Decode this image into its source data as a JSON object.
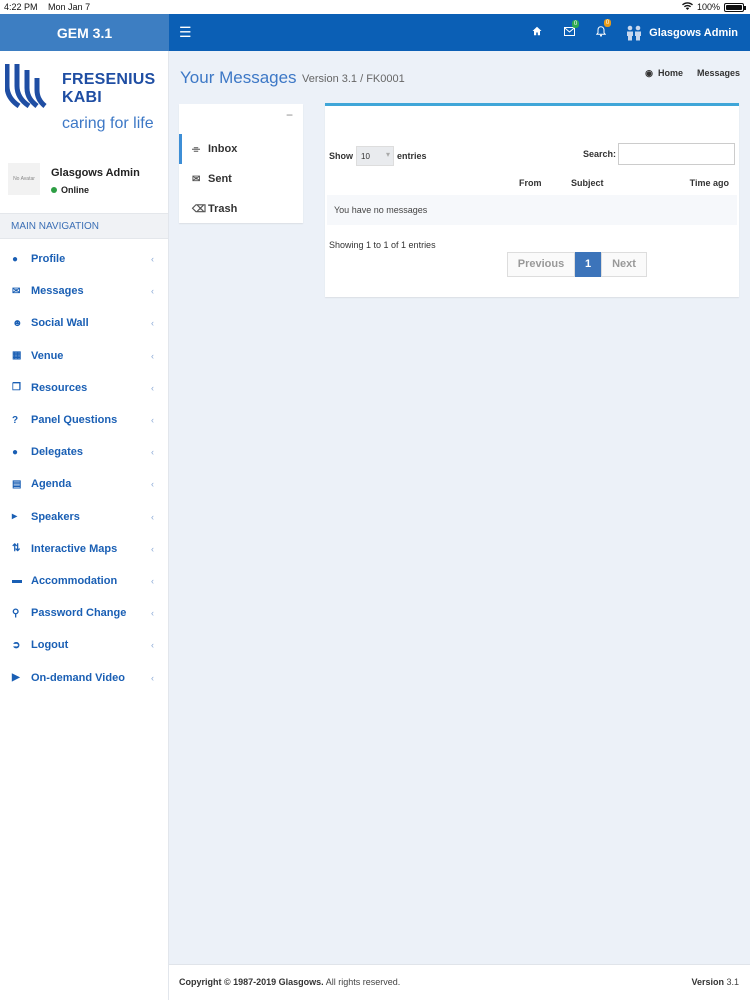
{
  "status_bar": {
    "time": "4:22 PM",
    "date": "Mon Jan 7",
    "battery": "100%"
  },
  "app": {
    "brand": "GEM 3.1"
  },
  "header": {
    "mail_badge": "0",
    "bell_badge": "0",
    "user_name": "Glasgows Admin",
    "colors": {
      "brand_bg": "#3d7ec2",
      "navbar_bg": "#0b5fb5"
    }
  },
  "logo": {
    "line1": "FRESENIUS",
    "line2": "KABI",
    "tagline": "caring for life"
  },
  "user_panel": {
    "avatar_text": "No Avatar",
    "name": "Glasgows Admin",
    "status": "Online"
  },
  "sidebar": {
    "header": "MAIN NAVIGATION",
    "items": [
      {
        "label": "Profile",
        "icon": "user-icon"
      },
      {
        "label": "Messages",
        "icon": "envelope-icon"
      },
      {
        "label": "Social Wall",
        "icon": "users-icon"
      },
      {
        "label": "Venue",
        "icon": "building-icon"
      },
      {
        "label": "Resources",
        "icon": "copy-icon"
      },
      {
        "label": "Panel Questions",
        "icon": "question-icon"
      },
      {
        "label": "Delegates",
        "icon": "user-icon"
      },
      {
        "label": "Agenda",
        "icon": "calendar-icon"
      },
      {
        "label": "Speakers",
        "icon": "bullhorn-icon"
      },
      {
        "label": "Interactive Maps",
        "icon": "signpost-icon"
      },
      {
        "label": "Accommodation",
        "icon": "bed-icon"
      },
      {
        "label": "Password Change",
        "icon": "key-icon"
      },
      {
        "label": "Logout",
        "icon": "sign-out-icon"
      },
      {
        "label": "On-demand Video",
        "icon": "youtube-icon"
      }
    ]
  },
  "page": {
    "title": "Your Messages",
    "subtitle": "Version 3.1 / FK0001",
    "breadcrumb": {
      "home": "Home",
      "current": "Messages"
    }
  },
  "folders": {
    "collapse": "−",
    "items": [
      {
        "label": "Inbox",
        "icon": "inbox-icon"
      },
      {
        "label": "Sent",
        "icon": "envelope-icon"
      },
      {
        "label": "Trash",
        "icon": "trash-icon"
      }
    ]
  },
  "messages_table": {
    "show_label": "Show",
    "page_size": "10",
    "entries_label": "entries",
    "search_label": "Search:",
    "search_value": "",
    "columns": [
      "From",
      "Subject",
      "Time ago"
    ],
    "empty_text": "You have no messages",
    "info": "Showing 1 to 1 of 1 entries",
    "pagination": {
      "previous": "Previous",
      "current": "1",
      "next": "Next"
    }
  },
  "footer": {
    "copyright_bold": "Copyright © 1987-2019 Glasgows.",
    "copyright_rest": " All rights reserved.",
    "version_label": "Version",
    "version_value": " 3.1"
  }
}
